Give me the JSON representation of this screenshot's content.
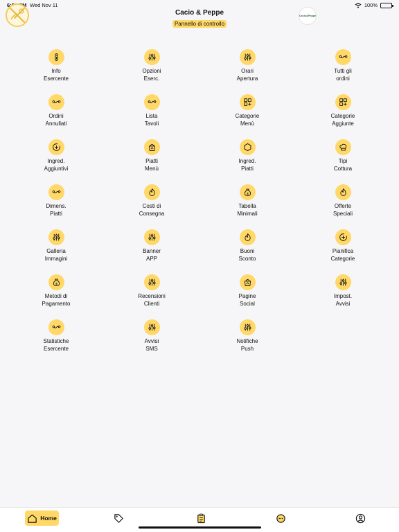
{
  "status_bar": {
    "time": "6:58 PM",
    "date": "Wed Nov 11",
    "battery": "100%"
  },
  "header": {
    "title": "Cacio & Peppe",
    "subtitle": "Pannello di controllo",
    "logo_right_text": "Cacio&Peppe"
  },
  "tiles": [
    {
      "icon": "info-icon",
      "line1": "Info",
      "line2": "Esercente"
    },
    {
      "icon": "sliders-icon",
      "line1": "Opzioni",
      "line2": "Eserc."
    },
    {
      "icon": "sliders-icon",
      "line1": "Orari",
      "line2": "Apertura"
    },
    {
      "icon": "route-icon",
      "line1": "Tutti gli",
      "line2": "ordini"
    },
    {
      "icon": "route-icon",
      "line1": "Ordini",
      "line2": "Annullati"
    },
    {
      "icon": "route-icon",
      "line1": "Lista",
      "line2": "Tavoli"
    },
    {
      "icon": "grid-plus-icon",
      "line1": "Categorie",
      "line2": "Menù"
    },
    {
      "icon": "grid-plus-icon",
      "line1": "Categorie",
      "line2": "Aggiunte"
    },
    {
      "icon": "add-circle-icon",
      "line1": "Ingred.",
      "line2": "Aggiuntivi"
    },
    {
      "icon": "bag-icon",
      "line1": "Piatti",
      "line2": "Menù"
    },
    {
      "icon": "hexagon-icon",
      "line1": "Ingred.",
      "line2": "Piatti"
    },
    {
      "icon": "chef-hat-icon",
      "line1": "Tipi",
      "line2": "Cottura"
    },
    {
      "icon": "route-icon",
      "line1": "Dimens.",
      "line2": "Piatti"
    },
    {
      "icon": "flame-icon",
      "line1": "Costi di",
      "line2": "Consegna"
    },
    {
      "icon": "money-bag-icon",
      "line1": "Tabella",
      "line2": "Minimali"
    },
    {
      "icon": "flame-icon",
      "line1": "Offerte",
      "line2": "Speciali"
    },
    {
      "icon": "sliders-icon",
      "line1": "Galleria",
      "line2": "Immagini"
    },
    {
      "icon": "sliders-icon",
      "line1": "Banner",
      "line2": "APP"
    },
    {
      "icon": "flame-icon",
      "line1": "Buoni",
      "line2": "Sconto"
    },
    {
      "icon": "add-circle-icon",
      "line1": "Pianifica",
      "line2": "Categorie"
    },
    {
      "icon": "money-bag-icon",
      "line1": "Metodi di",
      "line2": "Pagamento"
    },
    {
      "icon": "sliders-icon",
      "line1": "Recensioni",
      "line2": "Clienti"
    },
    {
      "icon": "bag-icon",
      "line1": "Pagine",
      "line2": "Social"
    },
    {
      "icon": "sliders-icon",
      "line1": "Impost.",
      "line2": "Avvisi"
    },
    {
      "icon": "route-icon",
      "line1": "Statistiche",
      "line2": "Esercente"
    },
    {
      "icon": "sliders-icon",
      "line1": "Avvisi",
      "line2": "SMS"
    },
    {
      "icon": "sliders-icon",
      "line1": "Notifiche",
      "line2": "Push"
    }
  ],
  "tab_bar": {
    "home_label": "Home",
    "tabs": [
      "home-icon",
      "tag-icon",
      "clipboard-icon",
      "chat-icon",
      "profile-icon"
    ]
  },
  "colors": {
    "accent": "#ffd867",
    "background": "#f6f6f8"
  }
}
